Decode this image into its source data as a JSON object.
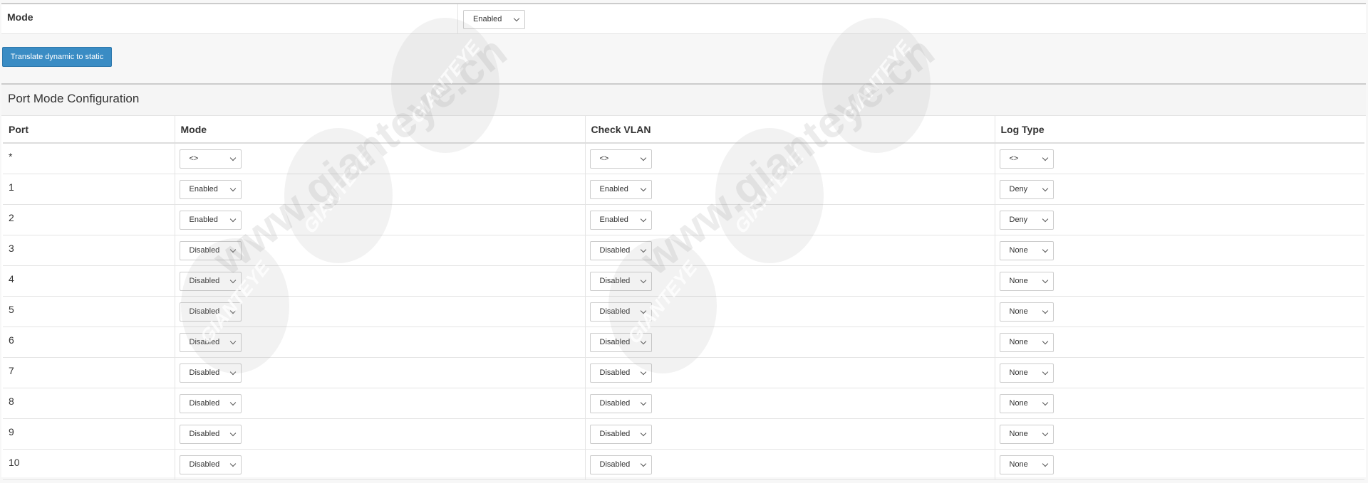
{
  "global": {
    "mode_label": "Mode",
    "mode_value": "Enabled"
  },
  "translate_button": "Translate dynamic to static",
  "config": {
    "title": "Port Mode Configuration",
    "columns": [
      "Port",
      "Mode",
      "Check VLAN",
      "Log Type"
    ],
    "rows": [
      {
        "port": "*",
        "mode": "<>",
        "check_vlan": "<>",
        "log_type": "<>"
      },
      {
        "port": "1",
        "mode": "Enabled",
        "check_vlan": "Enabled",
        "log_type": "Deny"
      },
      {
        "port": "2",
        "mode": "Enabled",
        "check_vlan": "Enabled",
        "log_type": "Deny"
      },
      {
        "port": "3",
        "mode": "Disabled",
        "check_vlan": "Disabled",
        "log_type": "None"
      },
      {
        "port": "4",
        "mode": "Disabled",
        "check_vlan": "Disabled",
        "log_type": "None"
      },
      {
        "port": "5",
        "mode": "Disabled",
        "check_vlan": "Disabled",
        "log_type": "None"
      },
      {
        "port": "6",
        "mode": "Disabled",
        "check_vlan": "Disabled",
        "log_type": "None"
      },
      {
        "port": "7",
        "mode": "Disabled",
        "check_vlan": "Disabled",
        "log_type": "None"
      },
      {
        "port": "8",
        "mode": "Disabled",
        "check_vlan": "Disabled",
        "log_type": "None"
      },
      {
        "port": "9",
        "mode": "Disabled",
        "check_vlan": "Disabled",
        "log_type": "None"
      },
      {
        "port": "10",
        "mode": "Disabled",
        "check_vlan": "Disabled",
        "log_type": "None"
      }
    ]
  },
  "watermark": {
    "brand": "GIANTEYE",
    "url": "www.gianteye.cn"
  },
  "icons": {
    "dropdown": "chevron-down-icon"
  }
}
